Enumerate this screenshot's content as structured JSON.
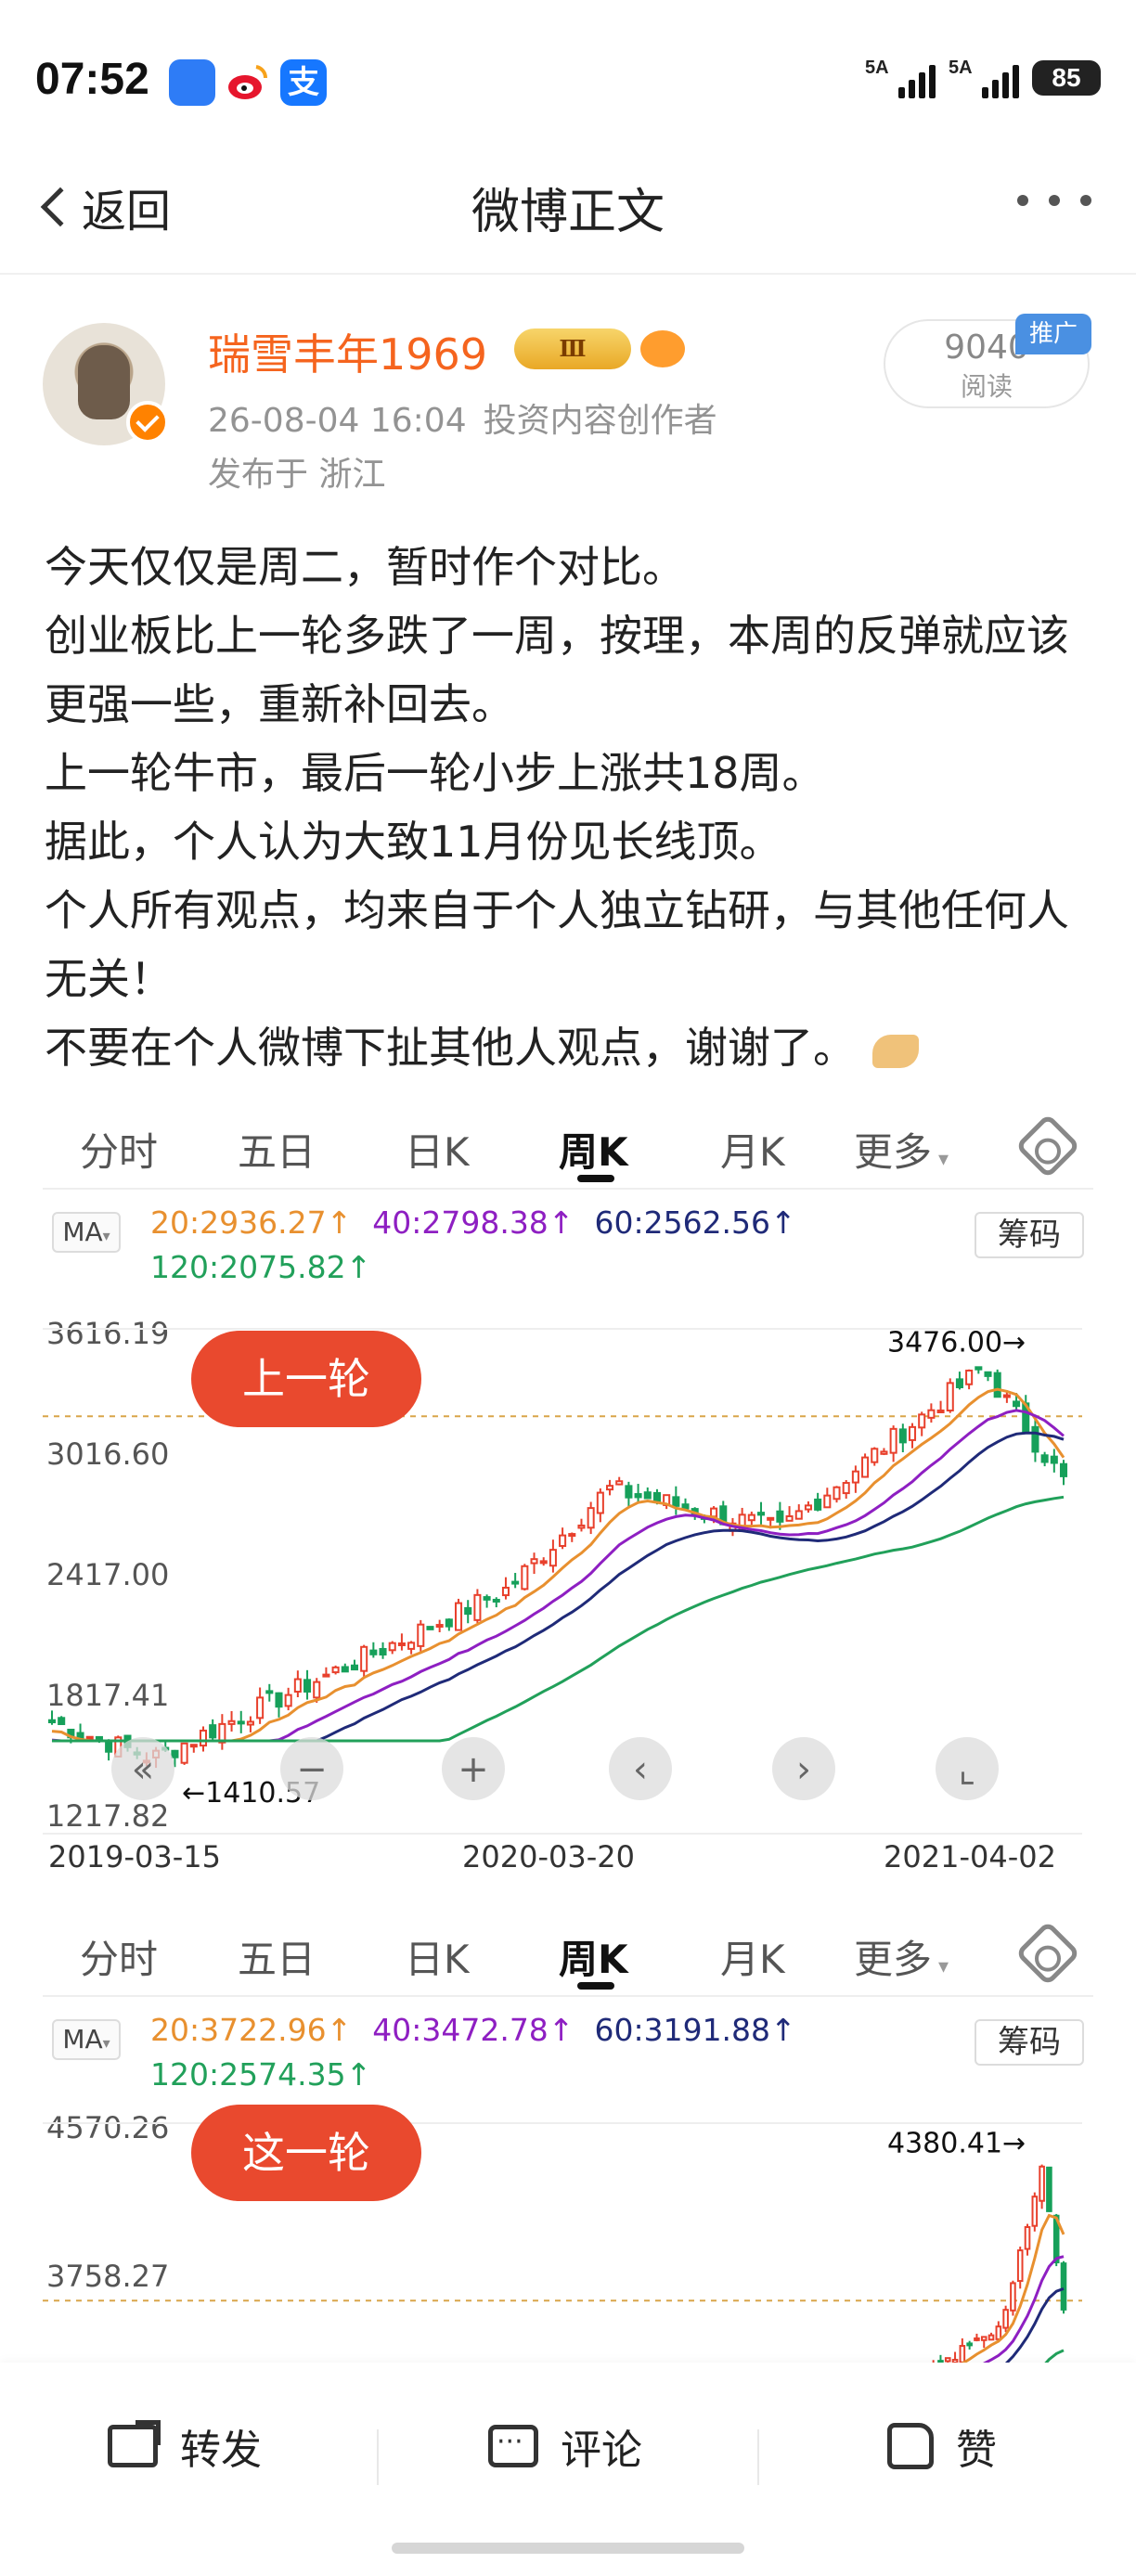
{
  "status_bar": {
    "time": "07:52",
    "sim1": "5A",
    "sim2": "5A",
    "battery": "85",
    "alipay_glyph": "支"
  },
  "nav": {
    "back_label": "返回",
    "title": "微博正文"
  },
  "author": {
    "name": "瑞雪丰年1969",
    "badge_level": "Ⅲ",
    "post_time": "26-08-04 16:04",
    "role": "投资内容创作者",
    "location": "发布于 浙江",
    "views_count": "9040",
    "views_label": "阅读",
    "promo_tag": "推广"
  },
  "post": {
    "lines": [
      "今天仅仅是周二，暂时作个对比。",
      "创业板比上一轮多跌了一周，按理，本周的反弹就应该更强一些，重新补回去。",
      "上一轮牛市，最后一轮小步上涨共18周。",
      "据此，个人认为大致11月份见长线顶。",
      "个人所有观点，均来自于个人独立钻研，与其他任何人无关！",
      "不要在个人微博下扯其他人观点，谢谢了。"
    ]
  },
  "chart_tabs": [
    "分时",
    "五日",
    "日K",
    "周K",
    "月K",
    "更多"
  ],
  "colors": {
    "up": "#e8402c",
    "down": "#16a05a",
    "ma20": "#e8902f",
    "ma40": "#8e1fc2",
    "ma60": "#1f2a78",
    "ma120": "#21a05a"
  },
  "chart_data": [
    {
      "type": "candlestick",
      "tag": "上一轮",
      "ma_button": "MA",
      "chip_button": "筹码",
      "ma": {
        "ma20": "20:2936.27↑",
        "ma40": "40:2798.38↑",
        "ma60": "60:2562.56↑",
        "ma120": "120:2075.82↑"
      },
      "y_ticks": [
        "3616.19",
        "3016.60",
        "2417.00",
        "1817.41",
        "1217.82"
      ],
      "ylim": [
        1217.82,
        3616.19
      ],
      "x_ticks": [
        "2019-03-15",
        "2020-03-20",
        "2021-04-02"
      ],
      "high_label": "3476.00→",
      "low_label": "←1410.57",
      "high": 3476.0,
      "low": 1410.57,
      "ref_line": 3200
    },
    {
      "type": "candlestick",
      "tag": "这一轮",
      "ma_button": "MA",
      "chip_button": "筹码",
      "ma": {
        "ma20": "20:3722.96↑",
        "ma40": "40:3472.78↑",
        "ma60": "60:3191.88↑",
        "ma120": "120:2574.35↑"
      },
      "y_ticks": [
        "4570.26",
        "3758.27"
      ],
      "ylim": [
        2946.28,
        4570.26
      ],
      "high_label": "4380.41→",
      "high": 4380.41,
      "ref_line": 3620
    }
  ],
  "toolbar": {
    "repost": "转发",
    "comment": "评论",
    "like": "赞"
  }
}
